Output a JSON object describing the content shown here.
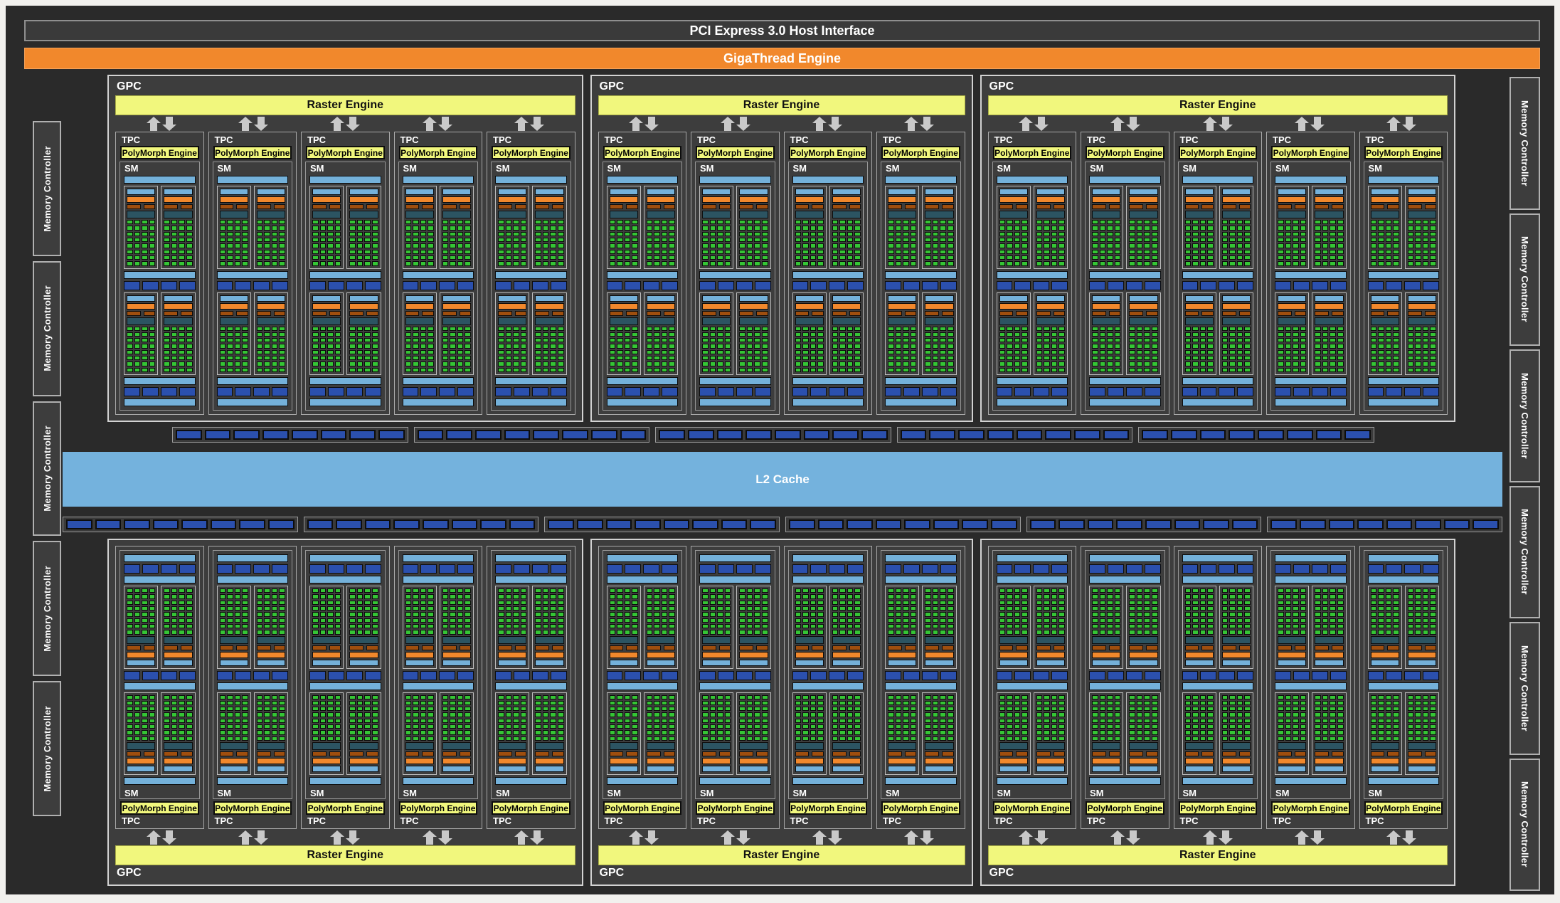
{
  "header": {
    "pci": "PCI Express 3.0 Host Interface",
    "gigathread": "GigaThread Engine"
  },
  "l2": {
    "label": "L2 Cache"
  },
  "labels": {
    "gpc": "GPC",
    "tpc": "TPC",
    "sm": "SM",
    "raster": "Raster Engine",
    "polymorph": "PolyMorph Engine",
    "memory_controller": "Memory Controller"
  },
  "memory_controllers": {
    "left_count": 5,
    "right_count": 6
  },
  "gpcs": [
    {
      "row": "top",
      "tpc_count": 5
    },
    {
      "row": "top",
      "tpc_count": 4
    },
    {
      "row": "top",
      "tpc_count": 5
    },
    {
      "row": "bottom",
      "tpc_count": 5
    },
    {
      "row": "bottom",
      "tpc_count": 4
    },
    {
      "row": "bottom",
      "tpc_count": 5
    }
  ],
  "sm_structure": {
    "processing_blocks_per_sm": 4,
    "core_grid": {
      "rows": 8,
      "cols": 4
    },
    "ldst_segments_per_row": 4,
    "ldst_rows_per_sm": 2
  },
  "crossbar": {
    "above_l2_groups": 5,
    "below_l2_groups": 6,
    "segments_per_group": 8
  },
  "colors": {
    "canvas": "#2a2a2a",
    "frame": "#f2f1ee",
    "box_fill": "#3d3d3d",
    "orange": "#f1882c",
    "yellow": "#f1f77d",
    "light_blue": "#74b1da",
    "l2_blue": "#74b2dd",
    "dark_blue": "#2b50ae",
    "green": "#35c535",
    "brown": "#9f4e0e",
    "teal": "#2c5462",
    "arrow_gray": "#c9c9c9"
  }
}
